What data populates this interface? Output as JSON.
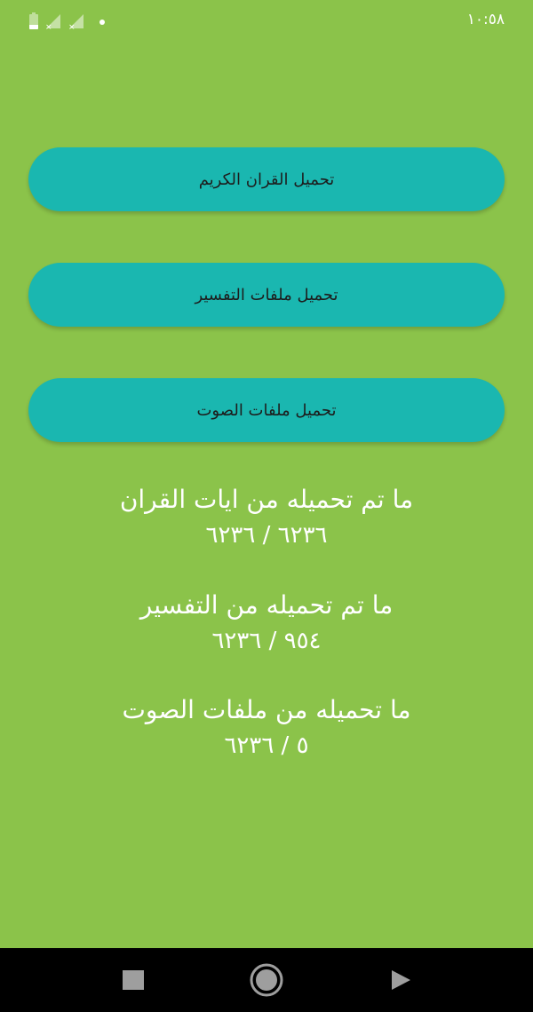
{
  "status_bar": {
    "time": "١٠:٥٨",
    "icons": [
      "battery-icon",
      "signal-off-icon",
      "signal-off-icon",
      "notification-dot-icon"
    ]
  },
  "buttons": {
    "quran": "تحميل القران الكريم",
    "tafsir": "تحميل ملفات التفسير",
    "audio": "تحميل ملفات الصوت"
  },
  "stats": {
    "quran": {
      "title": "ما تم تحميله من ايات القران",
      "count": "٦٢٣٦ / ٦٢٣٦"
    },
    "tafsir": {
      "title": "ما تم تحميله من التفسير",
      "count": "٩٥٤ / ٦٢٣٦"
    },
    "audio": {
      "title": "ما تحميله من ملفات الصوت",
      "count": "٥ / ٦٢٣٦"
    }
  },
  "nav_bar": {
    "icons": [
      "square-recents-icon",
      "circle-home-icon",
      "triangle-back-icon"
    ]
  },
  "colors": {
    "background": "#8bc34a",
    "button": "#1ab7b0",
    "nav_bar": "#000000"
  }
}
